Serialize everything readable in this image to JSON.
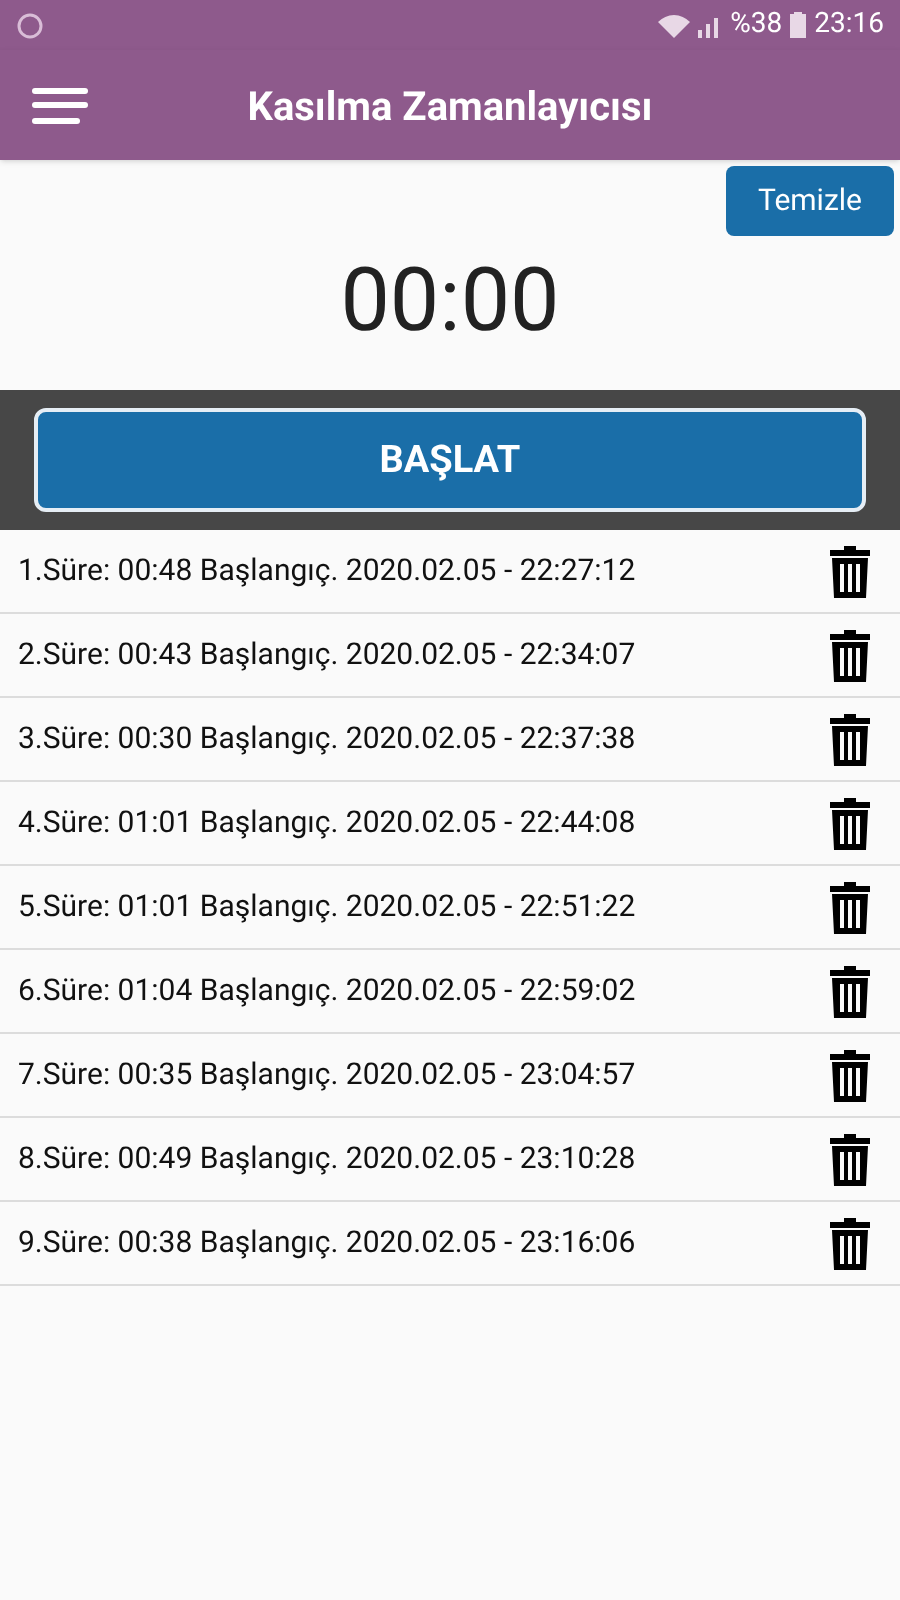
{
  "status_bar": {
    "battery": "%38",
    "time": "23:16"
  },
  "app_bar": {
    "title": "Kasılma Zamanlayıcısı"
  },
  "clear_button": "Temizle",
  "timer": "00:00",
  "start_button": "BAŞLAT",
  "entries": [
    {
      "text": "1.Süre: 00:48 Başlangıç. 2020.02.05 - 22:27:12"
    },
    {
      "text": "2.Süre: 00:43 Başlangıç. 2020.02.05 - 22:34:07"
    },
    {
      "text": "3.Süre: 00:30 Başlangıç. 2020.02.05 - 22:37:38"
    },
    {
      "text": "4.Süre: 01:01 Başlangıç. 2020.02.05 - 22:44:08"
    },
    {
      "text": "5.Süre: 01:01 Başlangıç. 2020.02.05 - 22:51:22"
    },
    {
      "text": "6.Süre: 01:04 Başlangıç. 2020.02.05 - 22:59:02"
    },
    {
      "text": "7.Süre: 00:35 Başlangıç. 2020.02.05 - 23:04:57"
    },
    {
      "text": "8.Süre: 00:49 Başlangıç. 2020.02.05 - 23:10:28"
    },
    {
      "text": "9.Süre: 00:38 Başlangıç. 2020.02.05 - 23:16:06"
    }
  ]
}
